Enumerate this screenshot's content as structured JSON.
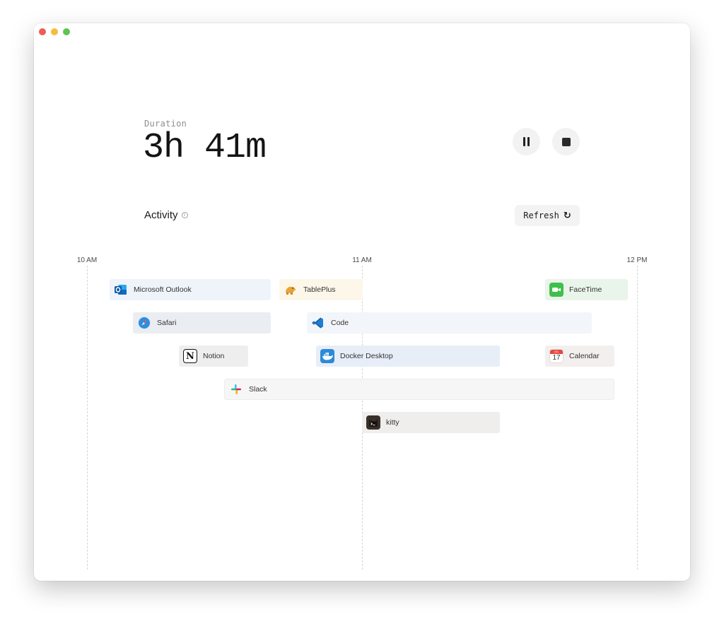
{
  "duration": {
    "label": "Duration",
    "value": "3h 41m"
  },
  "controls": {
    "pause_label": "pause",
    "stop_label": "stop"
  },
  "activity": {
    "title": "Activity",
    "refresh_label": "Refresh"
  },
  "timeline": {
    "ticks": [
      "10 AM",
      "11 AM",
      "12 PM"
    ],
    "apps": [
      {
        "name": "Microsoft Outlook",
        "icon": "outlook-icon",
        "color": "#0f6cbd"
      },
      {
        "name": "TablePlus",
        "icon": "tableplus-icon",
        "color": "#e8a33a"
      },
      {
        "name": "FaceTime",
        "icon": "facetime-icon",
        "color": "#3fbf4c"
      },
      {
        "name": "Safari",
        "icon": "safari-icon",
        "color": "#2f8de0"
      },
      {
        "name": "Code",
        "icon": "vscode-icon",
        "color": "#1f7ed4"
      },
      {
        "name": "Notion",
        "icon": "notion-icon",
        "color": "#111111"
      },
      {
        "name": "Docker Desktop",
        "icon": "docker-icon",
        "color": "#2c8ad8"
      },
      {
        "name": "Calendar",
        "icon": "calendar-icon",
        "color": "#e8453c",
        "month": "JUL",
        "day": "17"
      },
      {
        "name": "Slack",
        "icon": "slack-icon",
        "color": "#4a154b"
      },
      {
        "name": "kitty",
        "icon": "kitty-icon",
        "color": "#3a2f2a"
      }
    ]
  },
  "colors": {
    "outlook_bar": "#eff4fb",
    "tableplus_bar": "#fcf7e9",
    "facetime_bar": "#e9f4ea",
    "safari_bar": "#eaeef3",
    "code_bar": "#f2f5f9",
    "notion_bar": "#eeeeee",
    "docker_bar": "#e7eef8",
    "calendar_bar": "#f3efee",
    "slack_bar": "#f6f6f6",
    "kitty_bar": "#efeeed"
  }
}
